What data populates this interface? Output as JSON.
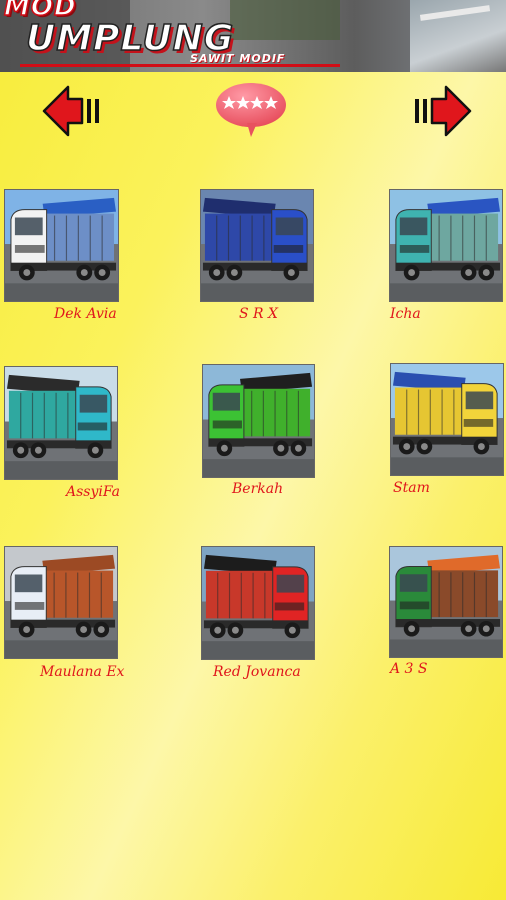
{
  "banner": {
    "prefix": "MOD",
    "title": "UMPLUNG",
    "subtitle": "SAWIT MODIF"
  },
  "nav": {
    "prev_icon": "arrow-left-icon",
    "next_icon": "arrow-right-icon",
    "rate_icon": "rate-stars-bubble-icon",
    "rate_stars": 4
  },
  "colors": {
    "background": "#fbf25c",
    "accent_red": "#e0161c",
    "bubble": "#f06a7a"
  },
  "items": [
    {
      "label": "Dek Avia",
      "cab": "#f2f2f2",
      "cover": "#2a5fc4",
      "body": "#6d8fc7",
      "sky": "#7fb3e6"
    },
    {
      "label": "S R X",
      "cab": "#2a4fc8",
      "cover": "#1f2e6e",
      "body": "#2e48a8",
      "sky": "#6a86b0"
    },
    {
      "label": "Icha",
      "cab": "#3fb3b0",
      "cover": "#2a55c2",
      "body": "#6ea7a0",
      "sky": "#8ec1e4"
    },
    {
      "label": "AssyiFa",
      "cab": "#2fb8c9",
      "cover": "#2b2b2b",
      "body": "#2fa8a0",
      "sky": "#c9dce8"
    },
    {
      "label": "Berkah",
      "cab": "#3cc234",
      "cover": "#1f1f1f",
      "body": "#40b02c",
      "sky": "#8db8d8"
    },
    {
      "label": "Stam",
      "cab": "#f2d43a",
      "cover": "#2a4fb0",
      "body": "#e6c632",
      "sky": "#9cc8ea"
    },
    {
      "label": "Maulana Ex",
      "cab": "#e8eef6",
      "cover": "#9c4a24",
      "body": "#b8562a",
      "sky": "#c4c8cc"
    },
    {
      "label": "Red Jovanca",
      "cab": "#e02424",
      "cover": "#1c1c1c",
      "body": "#c8382a",
      "sky": "#7ea4c4"
    },
    {
      "label": "A 3 S",
      "cab": "#2a8a3a",
      "cover": "#e06a2a",
      "body": "#8a4a2a",
      "sky": "#aac6dc"
    }
  ]
}
